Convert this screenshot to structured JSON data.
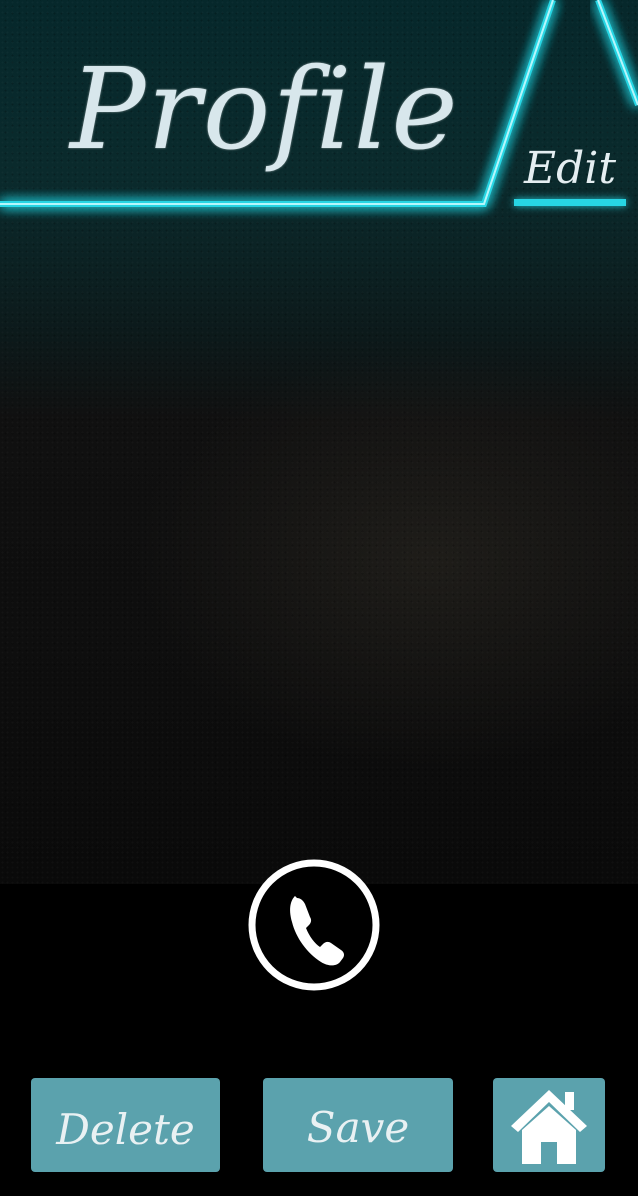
{
  "header": {
    "title": "Profile",
    "edit_label": "Edit"
  },
  "actions": {
    "delete_label": "Delete",
    "save_label": "Save"
  },
  "icons": {
    "call": "phone-icon",
    "home": "home-icon"
  },
  "colors": {
    "neon_accent": "#27d6e4",
    "button_bg": "#5ba2ad",
    "title_text": "#d8e7ec"
  }
}
